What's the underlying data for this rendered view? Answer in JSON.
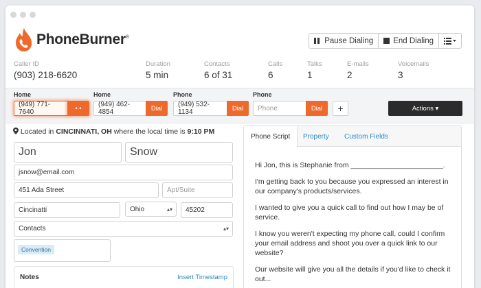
{
  "brand": {
    "name_bold": "PhoneBurner",
    "trademark": "®"
  },
  "toolbar": {
    "pause_label": "Pause Dialing",
    "end_label": "End Dialing",
    "menu_icon": "list-menu-icon"
  },
  "stats": [
    {
      "label": "Caller ID",
      "value": "(903) 218-6620"
    },
    {
      "label": "Duration",
      "value": "5 min"
    },
    {
      "label": "Contacts",
      "value": "6 of 31"
    },
    {
      "label": "Calls",
      "value": "6"
    },
    {
      "label": "Talks",
      "value": "1"
    },
    {
      "label": "E-mails",
      "value": "2"
    },
    {
      "label": "Voicemails",
      "value": "3"
    }
  ],
  "phones": [
    {
      "label": "Home",
      "number": "(949) 771-7640",
      "button": "• •",
      "active": true
    },
    {
      "label": "Home",
      "number": "(949) 462-4854",
      "button": "Dial",
      "active": false
    },
    {
      "label": "Phone",
      "number": "(949) 532-1134",
      "button": "Dial",
      "active": false
    },
    {
      "label": "Phone",
      "placeholder": "Phone",
      "button": "Dial",
      "active": false
    }
  ],
  "add_phone_label": "+",
  "actions_label": "Actions ▾",
  "location": {
    "prefix": "Located in",
    "city": "CINCINNATI, OH",
    "middle": "where the local time is",
    "time": "9:10 PM"
  },
  "contact": {
    "first_name": "Jon",
    "last_name": "Snow",
    "email": "jsnow@email.com",
    "street": "451 Ada Street",
    "apt_placeholder": "Apt/Suite",
    "city": "Cincinatti",
    "state": "Ohio",
    "zip": "45202",
    "list_select": "Contacts",
    "tag": "Convention"
  },
  "notes": {
    "title": "Notes",
    "timestamp_link": "Insert Timestamp"
  },
  "tabs": [
    "Phone Script",
    "Property",
    "Custom Fields"
  ],
  "script": [
    "Hi Jon, this is Stephanie from _______________________.",
    "I'm getting back to you because you expressed an interest in our company's products/services.",
    "I wanted to give you a quick call to find out how I may be of service.",
    "I know you weren't expecting my phone call, could I confirm your email address and shoot you over a quick link to our website?",
    "Our website will give you all the details if you'd like to check it out..."
  ],
  "colors": {
    "accent": "#ee6a2c",
    "link": "#2a8ac8",
    "dark": "#2b2b2b"
  }
}
